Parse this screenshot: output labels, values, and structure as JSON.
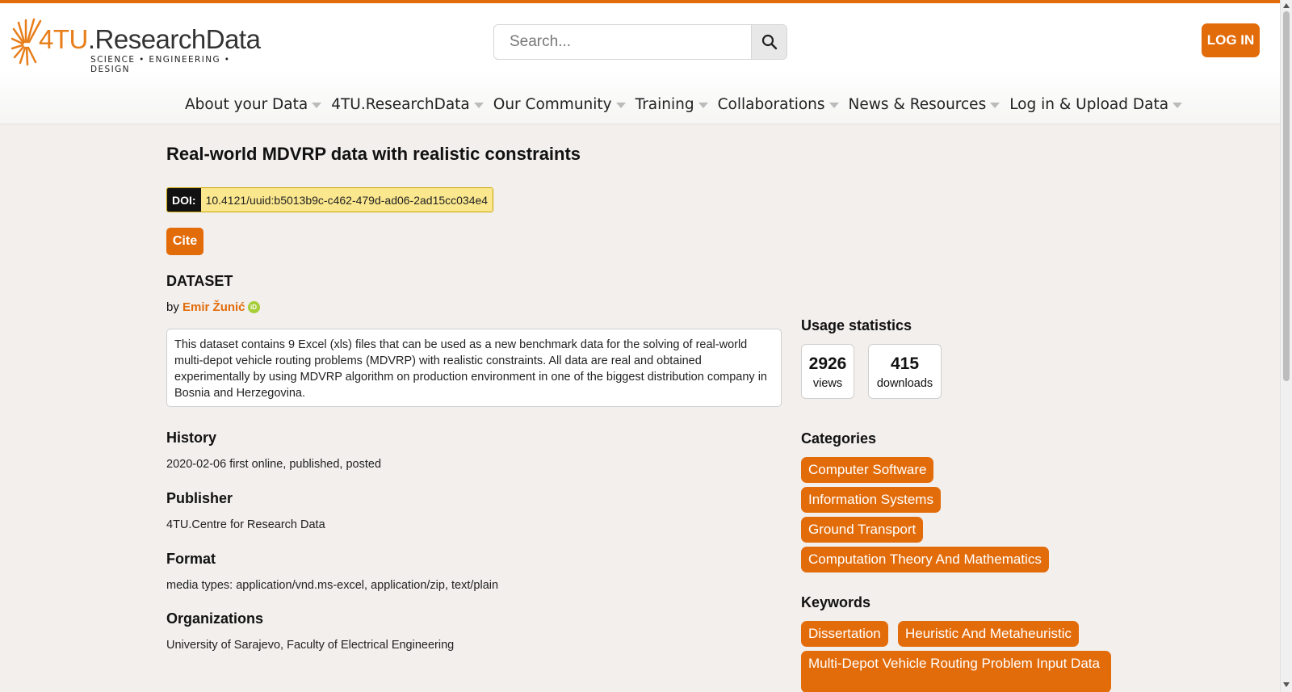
{
  "header": {
    "logo_prefix": "4TU",
    "logo_suffix": ".ResearchData",
    "logo_tagline": "SCIENCE • ENGINEERING • DESIGN",
    "search_placeholder": "Search...",
    "login_label": "LOG IN"
  },
  "nav": {
    "items": [
      "About your Data",
      "4TU.ResearchData",
      "Our Community",
      "Training",
      "Collaborations",
      "News & Resources",
      "Log in & Upload Data"
    ]
  },
  "dataset": {
    "title": "Real-world MDVRP data with realistic constraints",
    "doi_label": "DOI:",
    "doi": "10.4121/uuid:b5013b9c-c462-479d-ad06-2ad15cc034e4",
    "cite_label": "Cite",
    "type_label": "DATASET",
    "by_prefix": "by",
    "author": "Emir Žunić",
    "orcid_icon_text": "iD",
    "description": "This dataset contains 9 Excel (xls) files that can be used as a new benchmark data for the solving of real-world multi-depot vehicle routing problems (MDVRP) with realistic constraints. All data are real and obtained experimentally by using MDVRP algorithm on production environment in one of the biggest distribution company in Bosnia and Herzegovina.",
    "history_heading": "History",
    "history_value": "2020-02-06 first online, published, posted",
    "publisher_heading": "Publisher",
    "publisher_value": "4TU.Centre for Research Data",
    "format_heading": "Format",
    "format_value": "media types: application/vnd.ms-excel, application/zip, text/plain",
    "organizations_heading": "Organizations",
    "organizations_value": "University of Sarajevo, Faculty of Electrical Engineering"
  },
  "sidebar": {
    "usage_heading": "Usage statistics",
    "views_count": "2926",
    "views_label": "views",
    "downloads_count": "415",
    "downloads_label": "downloads",
    "categories_heading": "Categories",
    "categories": [
      "Computer Software",
      "Information Systems",
      "Ground Transport",
      "Computation Theory And Mathematics"
    ],
    "keywords_heading": "Keywords",
    "keywords": [
      "Dissertation",
      "Heuristic And Metaheuristic",
      "Multi-Depot Vehicle Routing Problem Input Data"
    ]
  },
  "colors": {
    "accent": "#e36c0a",
    "doi_highlight": "#fbe88e",
    "page_background": "#f2efed"
  }
}
